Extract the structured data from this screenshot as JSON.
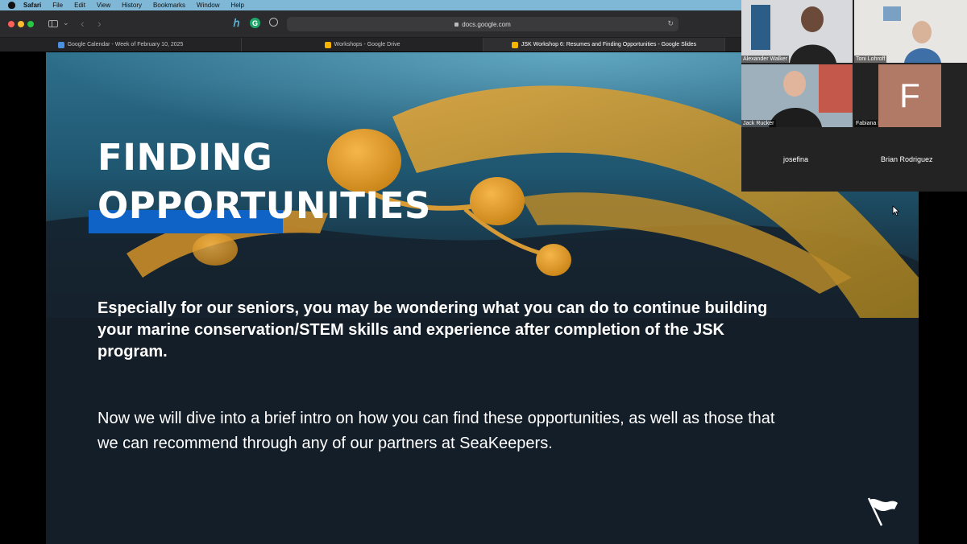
{
  "menubar": {
    "app": "Safari",
    "items": [
      "File",
      "Edit",
      "View",
      "History",
      "Bookmarks",
      "Window",
      "Help"
    ]
  },
  "toolbar": {
    "url": "docs.google.com"
  },
  "tabs": [
    {
      "label": "Google Calendar - Week of February 10, 2025",
      "favicon_color": "#4a90e2",
      "active": false
    },
    {
      "label": "Workshops - Google Drive",
      "favicon_color": "#f4b400",
      "active": false
    },
    {
      "label": "JSK Workshop 6: Resumes and Finding Opportunities - Google Slides",
      "favicon_color": "#f4b400",
      "active": true
    }
  ],
  "slide": {
    "title_line1": "FINDING",
    "title_line2": "OPPORTUNITIES",
    "paragraph1": "Especially for our seniors, you may be wondering what you can do to continue building your marine conservation/STEM skills and experience after completion of the JSK program.",
    "paragraph2": "Now we will dive into a brief intro on how you can find these opportunities, as well as those that we can recommend through any of our partners at SeaKeepers.",
    "accent_color": "#0f63c7"
  },
  "participants": [
    {
      "name": "Alexander Walker"
    },
    {
      "name": "Toni Lohroff"
    },
    {
      "name": "Jack Rucker"
    },
    {
      "name": "Fabiana Lara",
      "initial": "F"
    },
    {
      "name": "josefina"
    },
    {
      "name": "Brian Rodriguez"
    }
  ]
}
